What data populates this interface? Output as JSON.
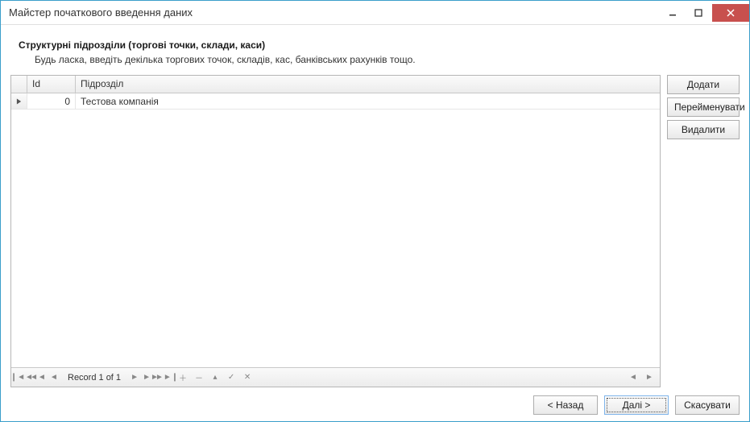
{
  "window": {
    "title": "Майстер початкового введення даних"
  },
  "section": {
    "title": "Структурні підрозділи (торгові точки, склади, каси)",
    "desc": "Будь ласка, введіть декілька торгових точок, складів, кас, банківських рахунків тощо."
  },
  "grid": {
    "headers": {
      "id": "Id",
      "name": "Підрозділ"
    },
    "rows": [
      {
        "id": "0",
        "name": "Тестова компанія"
      }
    ],
    "navigator": {
      "record": "Record 1 of 1"
    }
  },
  "side": {
    "add": "Додати",
    "rename": "Перейменувати",
    "delete": "Видалити"
  },
  "footer": {
    "back": "< Назад",
    "next": "Далі >",
    "cancel": "Скасувати"
  }
}
